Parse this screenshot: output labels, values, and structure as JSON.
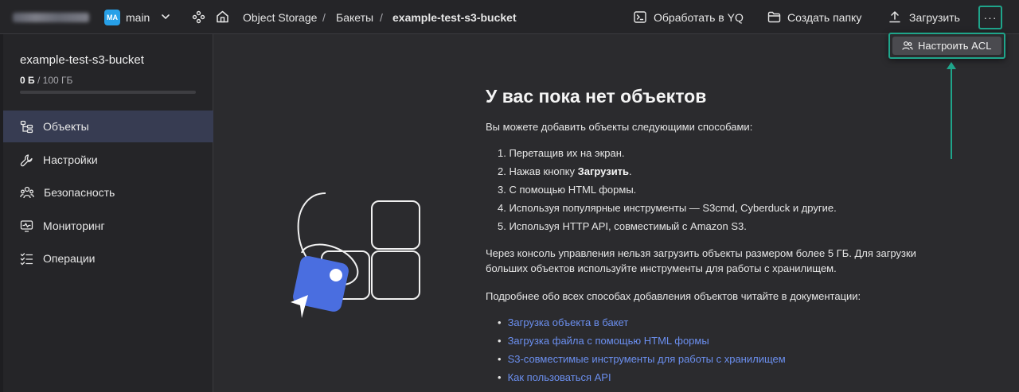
{
  "topbar": {
    "avatar_initials": "MA",
    "folder_name": "main",
    "breadcrumbs": [
      "Object Storage",
      "Бакеты",
      "example-test-s3-bucket"
    ],
    "separator": "/",
    "actions": {
      "process_yq": "Обработать в YQ",
      "create_folder": "Создать папку",
      "upload": "Загрузить",
      "more": "···"
    },
    "menu": {
      "acl": "Настроить ACL"
    }
  },
  "sidebar": {
    "bucket_name": "example-test-s3-bucket",
    "usage_used": "0 Б",
    "usage_total": "/ 100 ГБ",
    "usage_fraction": 0,
    "items": [
      {
        "label": "Объекты",
        "icon": "objects-icon",
        "active": true
      },
      {
        "label": "Настройки",
        "icon": "wrench-icon",
        "active": false
      },
      {
        "label": "Безопасность",
        "icon": "users-icon",
        "active": false
      },
      {
        "label": "Мониторинг",
        "icon": "monitor-icon",
        "active": false
      },
      {
        "label": "Операции",
        "icon": "checklist-icon",
        "active": false
      }
    ]
  },
  "empty_state": {
    "title": "У вас пока нет объектов",
    "intro": "Вы можете добавить объекты следующими способами:",
    "steps": [
      {
        "text": "1. Перетащив их на экран."
      },
      {
        "prefix": "2. Нажав кнопку ",
        "bold": "Загрузить",
        "suffix": "."
      },
      {
        "text": "3. С помощью HTML формы."
      },
      {
        "text": "4. Используя популярные инструменты — S3cmd, Cyberduck и другие."
      },
      {
        "text": "5. Используя HTTP API, совместимый с Amazon S3."
      }
    ],
    "limit_line1": "Через консоль управления нельзя загрузить объекты размером более 5 ГБ. Для загрузки",
    "limit_line2": "больших объектов используйте инструменты для работы с хранилищем.",
    "docs_intro": "Подробнее обо всех способах добавления объектов читайте в документации:",
    "links": [
      "Загрузка объекта в бакет",
      "Загрузка файла с помощью HTML формы",
      "S3-совместимые инструменты для работы с хранилищем",
      "Как пользоваться API"
    ]
  },
  "colors": {
    "accent": "#1fa58b",
    "link": "#6b8fef",
    "active_nav": "#373c52",
    "avatar": "#27a0e8",
    "illustration_blue": "#4a6ee0"
  }
}
